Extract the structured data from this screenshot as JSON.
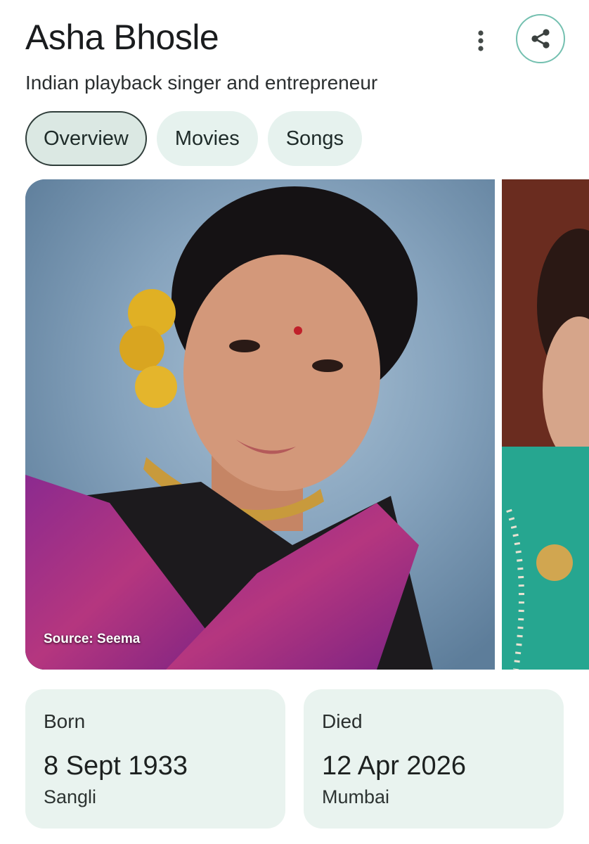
{
  "header": {
    "title": "Asha Bhosle",
    "subtitle": "Indian playback singer and entrepreneur",
    "more_icon": "more-vert-icon",
    "share_icon": "share-icon",
    "share_border_color": "#74c0b0"
  },
  "tabs": [
    {
      "label": "Overview",
      "active": true
    },
    {
      "label": "Movies",
      "active": false
    },
    {
      "label": "Songs",
      "active": false
    }
  ],
  "images": {
    "main_source": "Source: Seema"
  },
  "facts": {
    "born": {
      "label": "Born",
      "date": "8 Sept 1933",
      "place": "Sangli"
    },
    "died": {
      "label": "Died",
      "date": "12 Apr 2026",
      "place": "Mumbai"
    }
  },
  "colors": {
    "chip_bg": "#e6f2ee",
    "card_bg": "#e9f3ef"
  }
}
